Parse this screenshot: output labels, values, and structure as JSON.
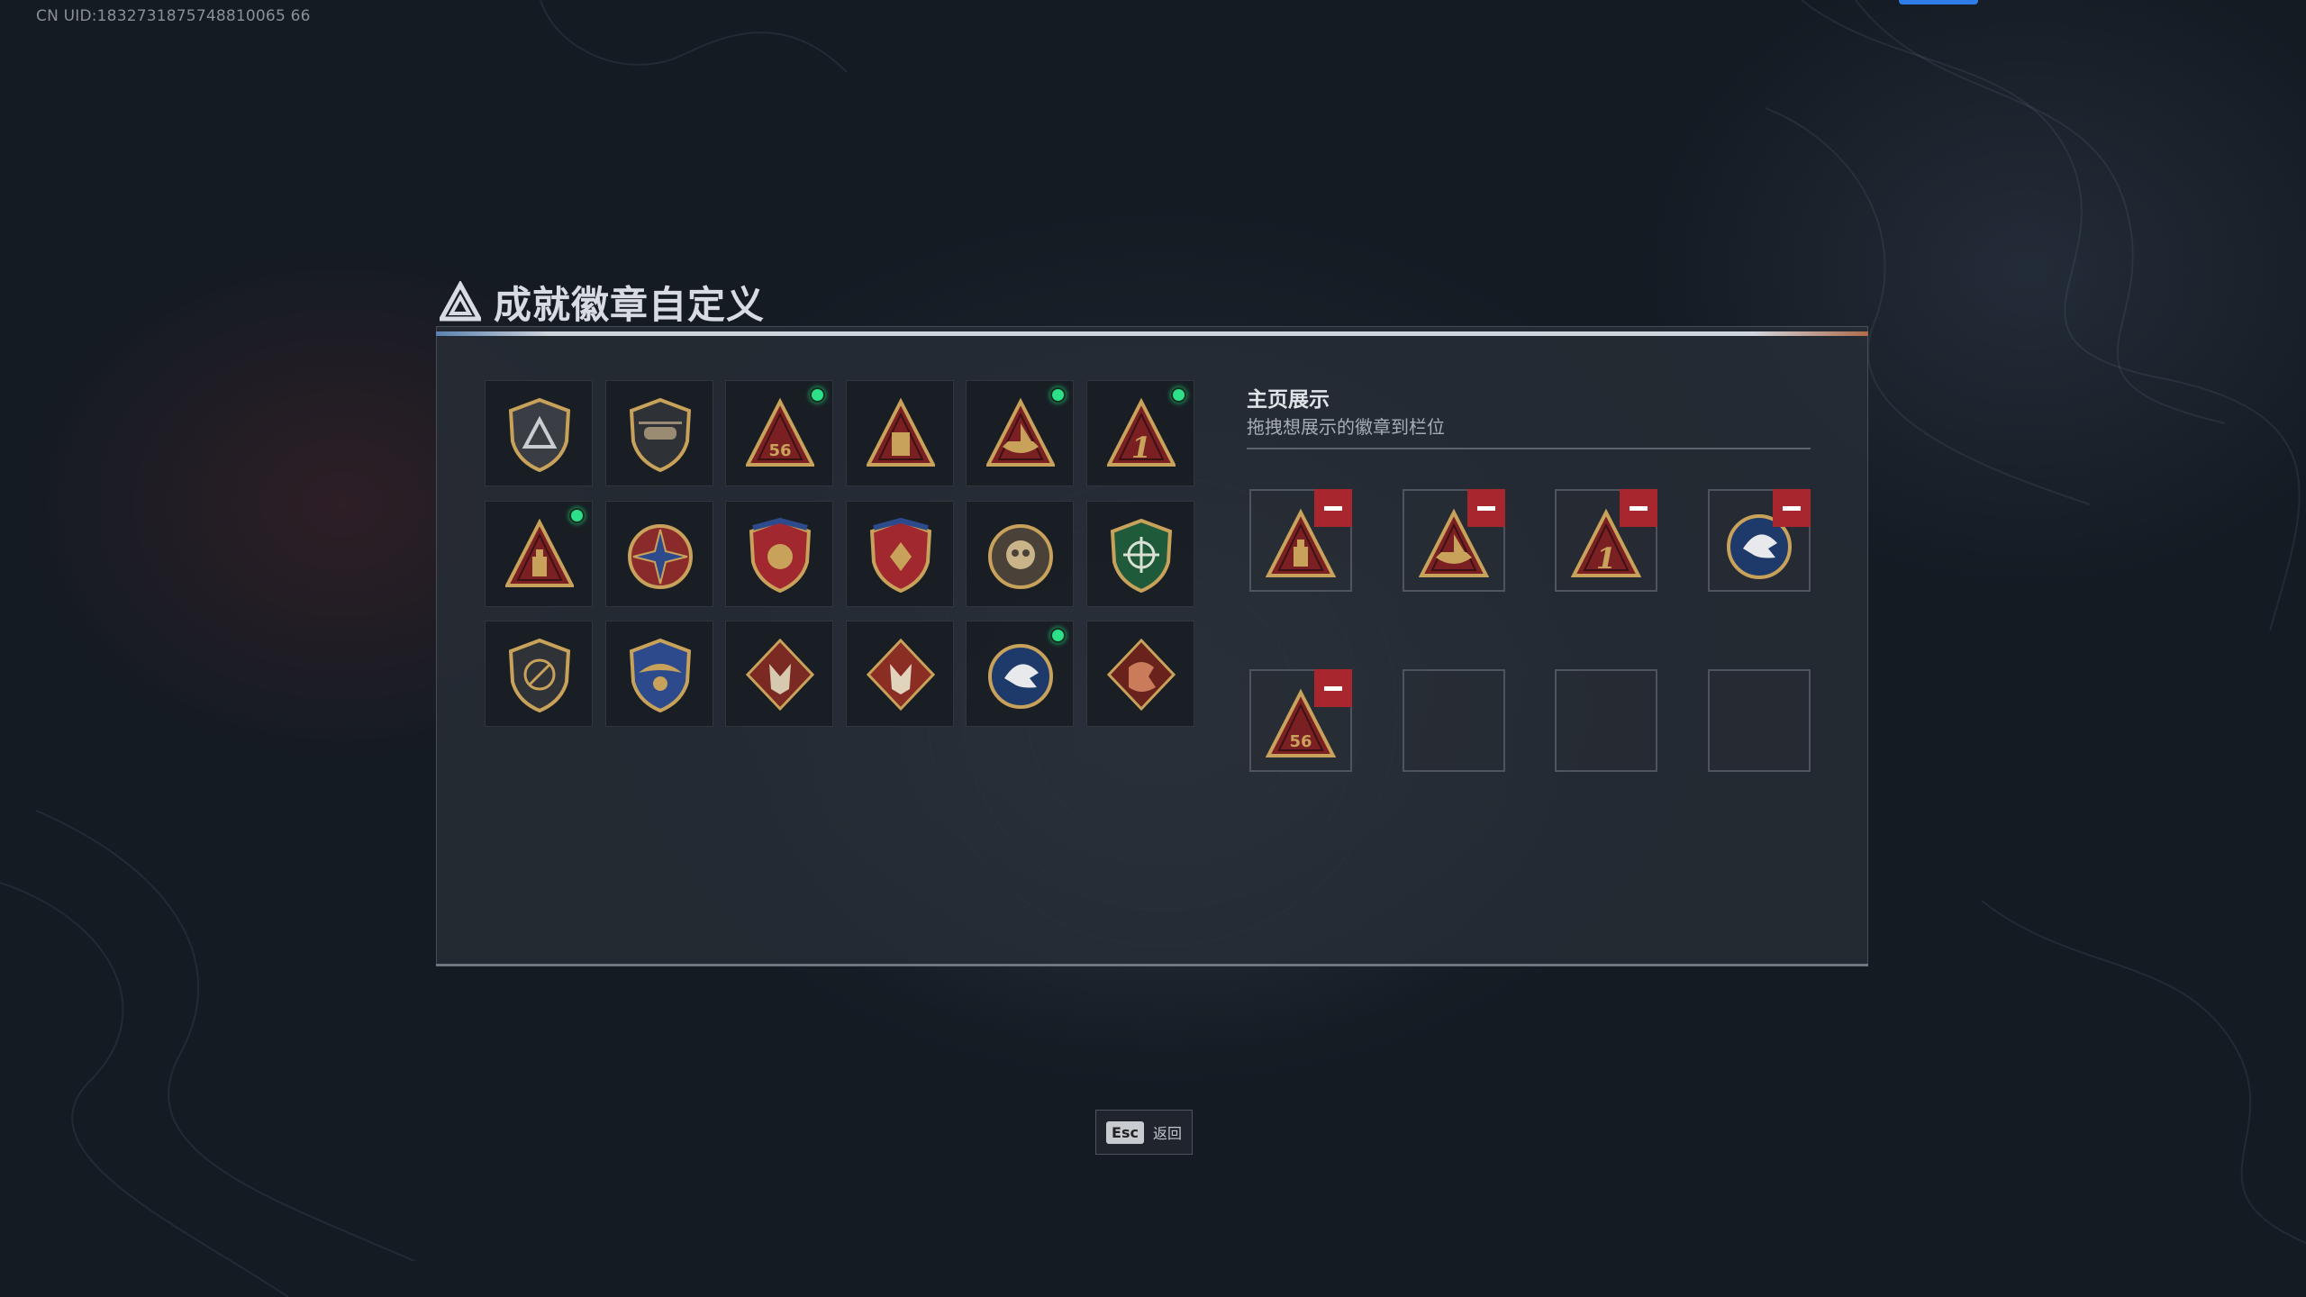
{
  "uid_text": "CN UID:1832731875748810065 66",
  "title_tag": "",
  "panel": {
    "title": "成就徽章自定义"
  },
  "showcase": {
    "title": "主页展示",
    "subtitle": "拖拽想展示的徽章到栏位"
  },
  "footer": {
    "esc_key": "Esc",
    "esc_label": "返回"
  },
  "colors": {
    "accent": "#2f7de8",
    "new_dot": "#2fe08a",
    "remove": "#a8262e",
    "gold": "#c8a25a",
    "crimson": "#7a1f22"
  },
  "badges": [
    {
      "icon": "shield-delta-badge-icon",
      "new": false
    },
    {
      "icon": "helicopter-shield-badge-icon",
      "new": false
    },
    {
      "icon": "triangle-56-badge-icon",
      "new": true
    },
    {
      "icon": "triangle-building-badge-icon",
      "new": false
    },
    {
      "icon": "triangle-ship-badge-icon",
      "new": true
    },
    {
      "icon": "triangle-number-one-badge-icon",
      "new": true
    },
    {
      "icon": "triangle-bottle-badge-icon",
      "new": true
    },
    {
      "icon": "star-compass-badge-icon",
      "new": false
    },
    {
      "icon": "winged-crest-badge-icon",
      "new": false
    },
    {
      "icon": "winged-gem-crest-badge-icon",
      "new": false
    },
    {
      "icon": "skull-medallion-badge-icon",
      "new": false
    },
    {
      "icon": "green-crosshair-shield-badge-icon",
      "new": false
    },
    {
      "icon": "no-gun-shield-badge-icon",
      "new": false
    },
    {
      "icon": "blue-wing-shield-badge-icon",
      "new": false
    },
    {
      "icon": "wolf-diamond-badge-icon",
      "new": false
    },
    {
      "icon": "wolf-diamond-red-badge-icon",
      "new": false
    },
    {
      "icon": "eagle-blue-medallion-badge-icon",
      "new": true
    },
    {
      "icon": "dragon-diamond-badge-icon",
      "new": false
    }
  ],
  "slots": [
    {
      "icon": "triangle-bottle-badge-icon",
      "filled": true
    },
    {
      "icon": "triangle-ship-badge-icon",
      "filled": true
    },
    {
      "icon": "triangle-number-one-badge-icon",
      "filled": true
    },
    {
      "icon": "eagle-blue-medallion-badge-icon",
      "filled": true
    },
    {
      "icon": "triangle-56-badge-icon",
      "filled": true
    },
    {
      "icon": "empty-slot",
      "filled": false
    },
    {
      "icon": "empty-slot",
      "filled": false
    },
    {
      "icon": "empty-slot",
      "filled": false
    }
  ]
}
